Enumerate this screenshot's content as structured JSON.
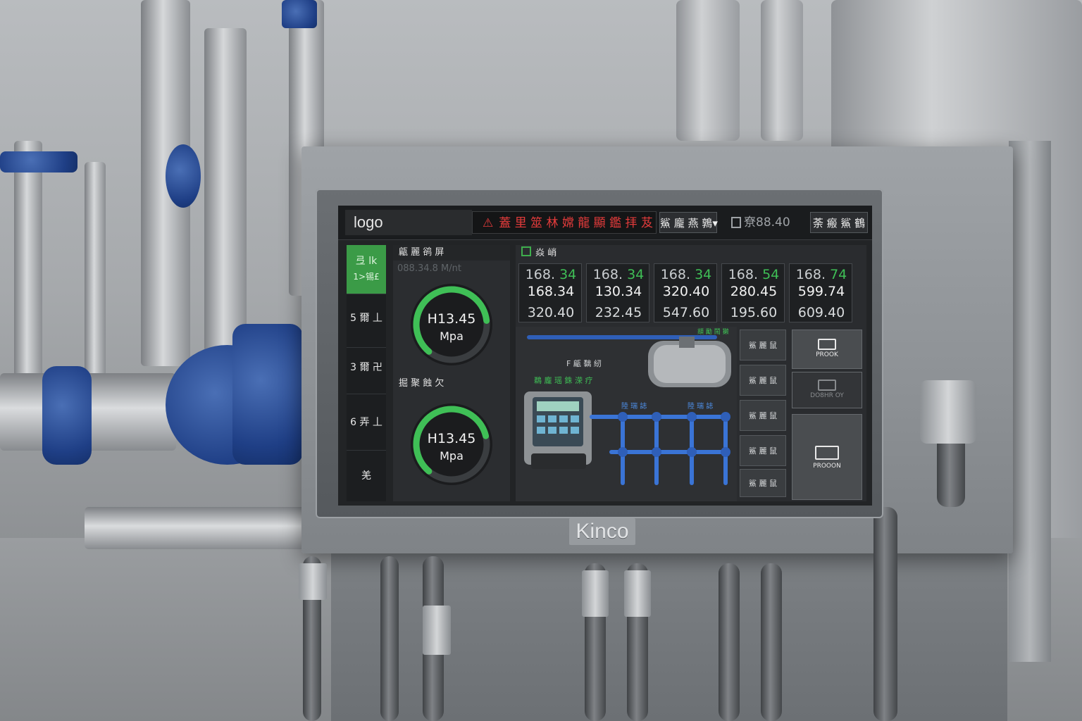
{
  "hmi": {
    "brand": "Kinco",
    "topbar": {
      "logo": "logo",
      "alarm_text": "蓋 里 筮 林 嫦 龍 顯 鑑 拝 芨",
      "dropdown_label": "鯊 龐 燕 鶉",
      "counter_text": "尞88.40",
      "right_button_label": "荼 瘢 鯊 鶴"
    },
    "nav": [
      {
        "line1": "弖 lk",
        "line2": "1>锡£",
        "active": true
      },
      {
        "line1": "5 爾 丄",
        "line2": "",
        "active": false
      },
      {
        "line1": "3 爾 卍",
        "line2": "",
        "active": false
      },
      {
        "line1": "6 弄 丄",
        "line2": "",
        "active": false
      },
      {
        "line1": "羌",
        "line2": "",
        "active": false
      }
    ],
    "gauges": [
      {
        "title": "甂 麗 鹆 屏",
        "subtitle": "088.34.8 M/nt",
        "value": "H13.45",
        "unit": "Mpa",
        "fraction": 0.62
      },
      {
        "title": "掘 聚 蝕 欠",
        "subtitle": "",
        "value": "H13.45",
        "unit": "Mpa",
        "fraction": 0.6
      }
    ],
    "content": {
      "title": "焱 峭",
      "cards": [
        {
          "top_gray": "168.",
          "top_green": "34",
          "mid": "168.34",
          "bottom": "320.40"
        },
        {
          "top_gray": "168.",
          "top_green": "34",
          "mid": "130.34",
          "bottom": "232.45"
        },
        {
          "top_gray": "168.",
          "top_green": "34",
          "mid": "320.40",
          "bottom": "547.60"
        },
        {
          "top_gray": "168.",
          "top_green": "54",
          "mid": "280.45",
          "bottom": "195.60"
        },
        {
          "top_gray": "168.",
          "top_green": "74",
          "mid": "599.74",
          "bottom": "609.40"
        }
      ],
      "diagram": {
        "label_f": "F 甂 黐 紉",
        "label_green": "鵜 龐 瑶 銖 溁 疗",
        "label_blue_1": "陸 瑞 誌",
        "label_blue_2": "陸 瑞 誌",
        "label_top_bar": "頫 勵 鬧 獭"
      },
      "side_buttons": [
        "鯊 麗 鼠",
        "鯊 麗 鼠",
        "鯊 麗 鼠",
        "鯊 麗 鼠",
        "鯊 麗 鼠"
      ],
      "big_buttons": [
        {
          "label": "PROOK"
        },
        {
          "label": "DO8HR OY"
        },
        {
          "label": "PROOON"
        }
      ]
    },
    "accent_green": "#3fbf56",
    "alarm_red": "#e33b3b"
  }
}
